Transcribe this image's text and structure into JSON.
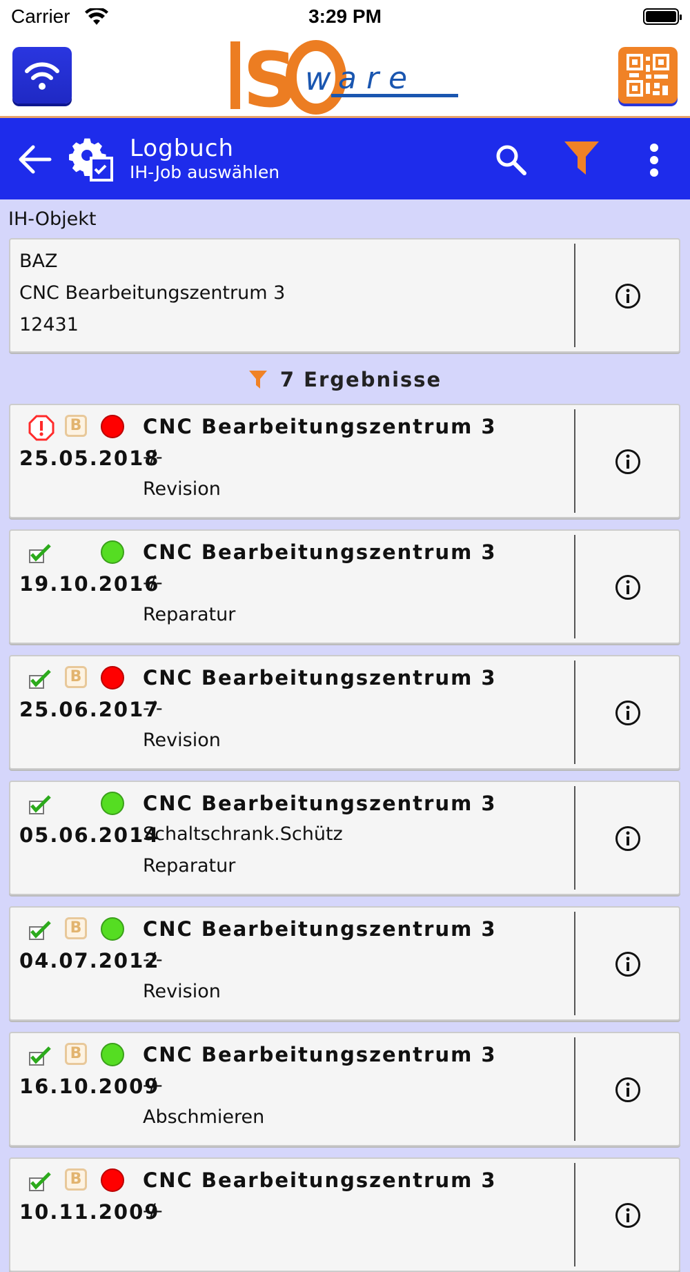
{
  "status_bar": {
    "carrier": "Carrier",
    "time": "3:29 PM"
  },
  "header": {
    "logo_text": "ISOware"
  },
  "app_bar": {
    "title": "Logbuch",
    "subtitle": "IH-Job auswählen"
  },
  "object_section": {
    "label": "IH-Objekt",
    "code": "BAZ",
    "name": "CNC Bearbeitungszentrum 3",
    "number": "12431"
  },
  "results_text": "7 Ergebnisse",
  "jobs": [
    {
      "date": "25.05.2018",
      "title": "CNC Bearbeitungszentrum 3",
      "sub": "-/-",
      "type": "Revision",
      "status_icon": "exclamation-icon",
      "badge": "B",
      "dot": "red"
    },
    {
      "date": "19.10.2016",
      "title": "CNC Bearbeitungszentrum 3",
      "sub": "-/-",
      "type": "Reparatur",
      "status_icon": "checkmark-icon",
      "badge": "",
      "dot": "green"
    },
    {
      "date": "25.06.2017",
      "title": "CNC Bearbeitungszentrum 3",
      "sub": "-/-",
      "type": "Revision",
      "status_icon": "checkmark-icon",
      "badge": "B",
      "dot": "red"
    },
    {
      "date": "05.06.2014",
      "title": "CNC Bearbeitungszentrum 3",
      "sub": "Schaltschrank.Schütz",
      "type": "Reparatur",
      "status_icon": "checkmark-icon",
      "badge": "",
      "dot": "green"
    },
    {
      "date": "04.07.2012",
      "title": "CNC Bearbeitungszentrum 3",
      "sub": "-/-",
      "type": "Revision",
      "status_icon": "checkmark-icon",
      "badge": "B",
      "dot": "green"
    },
    {
      "date": "16.10.2009",
      "title": "CNC Bearbeitungszentrum 3",
      "sub": "-/-",
      "type": "Abschmieren",
      "status_icon": "checkmark-icon",
      "badge": "B",
      "dot": "green"
    },
    {
      "date": "10.11.2009",
      "title": "CNC Bearbeitungszentrum 3",
      "sub": "-/-",
      "type": "",
      "status_icon": "checkmark-icon",
      "badge": "B",
      "dot": "red"
    }
  ],
  "colors": {
    "app_bar": "#1e2ceb",
    "background": "#d5d6fb",
    "accent_orange": "#f08226",
    "status_red": "#ff0000",
    "status_green": "#55dd22"
  }
}
